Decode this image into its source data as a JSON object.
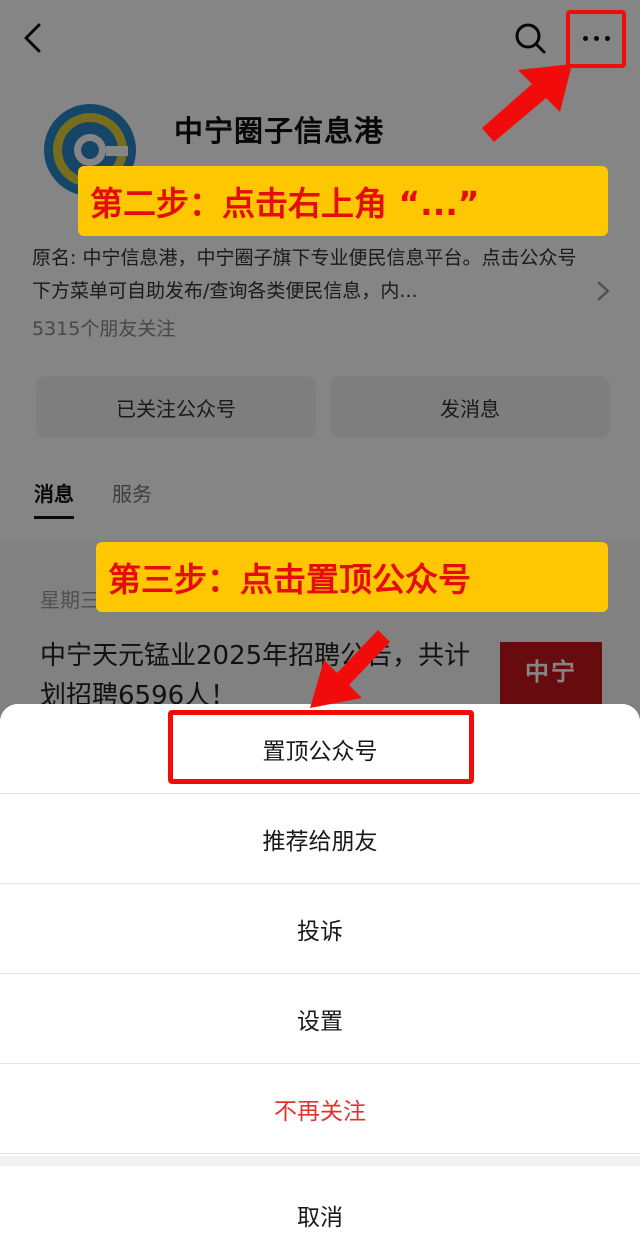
{
  "header": {
    "back_icon": "chevron-left-icon",
    "search_icon": "search-icon",
    "more_icon": "more-dots-icon"
  },
  "account": {
    "name": "中宁圈子信息港",
    "avatar_icon": "at-sign-logo-icon",
    "description": "原名: 中宁信息港，中宁圈子旗下专业便民信息平台。点击公众号下方菜单可自助发布/查询各类便民信息，内...",
    "followers": "5315个朋友关注",
    "followed_button": "已关注公众号",
    "message_button": "发消息"
  },
  "tabs": [
    {
      "label": "消息"
    },
    {
      "label": "服务"
    }
  ],
  "message": {
    "date": "星期三",
    "title": "中宁天元锰业2025年招聘公告，共计划招聘6596人！",
    "thumb_text": "中宁"
  },
  "annotations": {
    "step2": "第二步：点击右上角 “...”",
    "step3": "第三步：点击置顶公众号",
    "highlight_color": "#f20b0b",
    "banner_color": "#ffc702",
    "banner_text_color": "#e40d0d"
  },
  "sheet": {
    "items": [
      {
        "label": "置顶公众号"
      },
      {
        "label": "推荐给朋友"
      },
      {
        "label": "投诉"
      },
      {
        "label": "设置"
      },
      {
        "label": "不再关注"
      }
    ],
    "cancel": "取消",
    "danger_color": "#e0342b"
  }
}
